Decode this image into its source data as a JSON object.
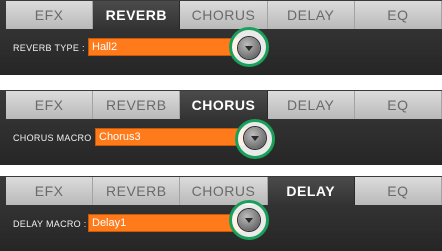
{
  "panels": [
    {
      "tabs": [
        "EFX",
        "REVERB",
        "CHORUS",
        "DELAY",
        "EQ"
      ],
      "active_tab": "REVERB",
      "row_label": "REVERB TYPE :",
      "value": "Hall2"
    },
    {
      "tabs": [
        "EFX",
        "REVERB",
        "CHORUS",
        "DELAY",
        "EQ"
      ],
      "active_tab": "CHORUS",
      "row_label": "CHORUS MACRO :",
      "value": "Chorus3"
    },
    {
      "tabs": [
        "EFX",
        "REVERB",
        "CHORUS",
        "DELAY",
        "EQ"
      ],
      "active_tab": "DELAY",
      "row_label": "DELAY MACRO :",
      "value": "Delay1"
    }
  ],
  "icons": {
    "dropdown": "chevron-down-icon",
    "highlight": "highlight-circle"
  },
  "colors": {
    "accent": "#ff7a1a",
    "highlight": "#1aa05a",
    "panel_bg": "#2e2e2e",
    "tab_inactive": "#c8c8c8"
  }
}
